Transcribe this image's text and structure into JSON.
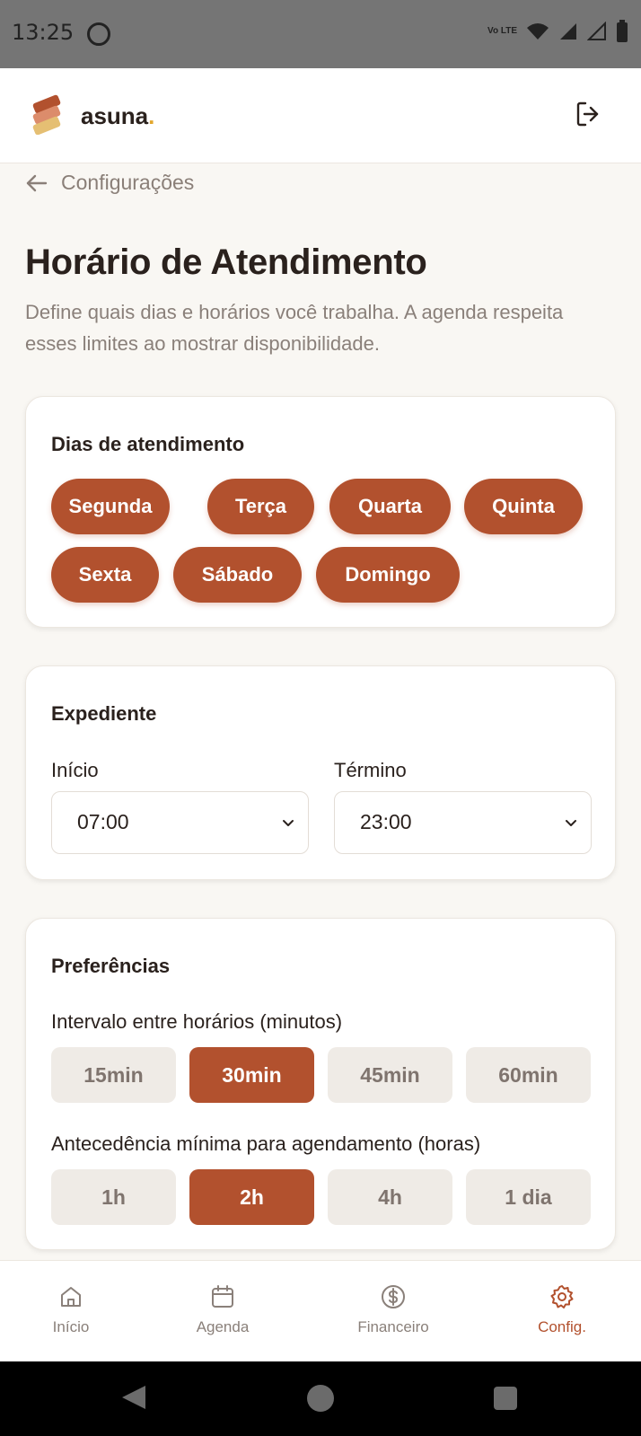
{
  "status_bar": {
    "time": "13:25",
    "network": "Vo LTE"
  },
  "app": {
    "brand": "asuna",
    "brand_dot": "."
  },
  "nav": {
    "back_label": "Configurações"
  },
  "page": {
    "title": "Horário de Atendimento",
    "description": "Define quais dias e horários você trabalha. A agenda respeita esses limites ao mostrar disponibilidade."
  },
  "days_card": {
    "title": "Dias de atendimento",
    "days": [
      {
        "label": "Segunda",
        "selected": true
      },
      {
        "label": "Terça",
        "selected": true
      },
      {
        "label": "Quarta",
        "selected": true
      },
      {
        "label": "Quinta",
        "selected": true
      },
      {
        "label": "Sexta",
        "selected": true
      },
      {
        "label": "Sábado",
        "selected": true
      },
      {
        "label": "Domingo",
        "selected": true
      }
    ]
  },
  "hours_card": {
    "title": "Expediente",
    "start_label": "Início",
    "start_value": "07:00",
    "end_label": "Término",
    "end_value": "23:00"
  },
  "prefs_card": {
    "title": "Preferências",
    "interval_label": "Intervalo entre horários (minutos)",
    "interval_options": [
      "15min",
      "30min",
      "45min",
      "60min"
    ],
    "interval_selected": "30min",
    "advance_label": "Antecedência mínima para agendamento (horas)",
    "advance_options": [
      "1h",
      "2h",
      "4h",
      "1 dia"
    ],
    "advance_selected": "2h"
  },
  "tabs": [
    {
      "label": "Início",
      "icon": "home-icon",
      "active": false
    },
    {
      "label": "Agenda",
      "icon": "calendar-icon",
      "active": false
    },
    {
      "label": "Financeiro",
      "icon": "dollar-icon",
      "active": false
    },
    {
      "label": "Config.",
      "icon": "gear-icon",
      "active": true
    }
  ],
  "colors": {
    "accent": "#b2512e",
    "background": "#f9f7f3",
    "muted": "#8a807a"
  }
}
